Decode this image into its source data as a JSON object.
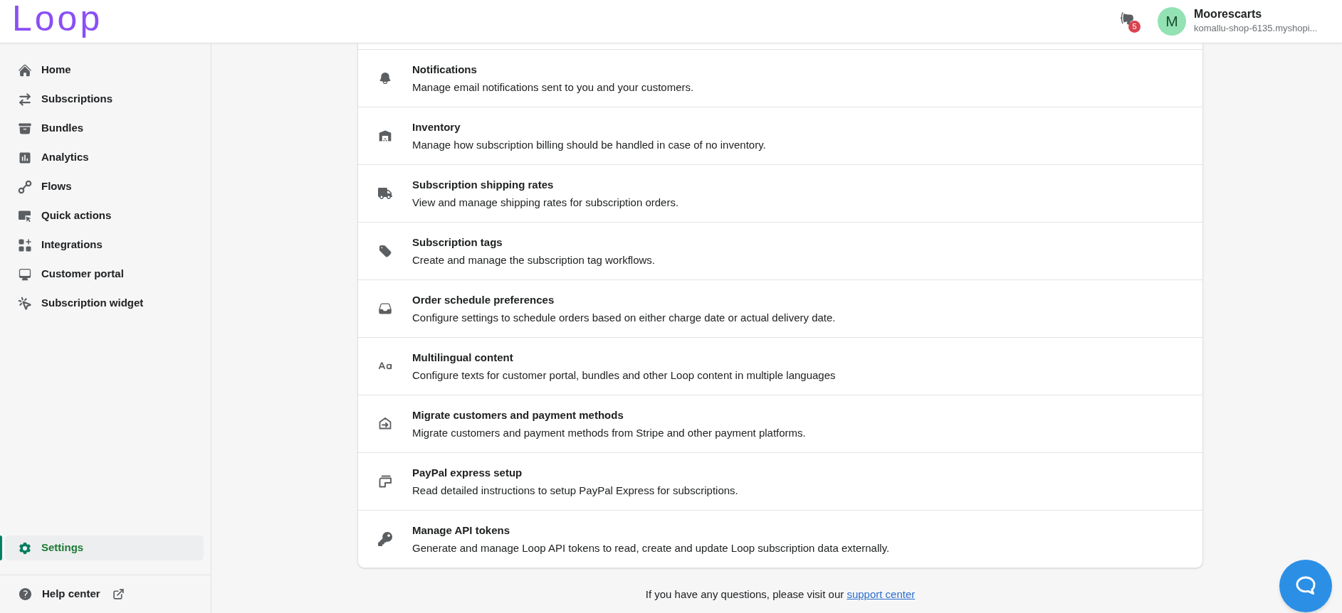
{
  "header": {
    "logo": "Loop",
    "announcements": {
      "badge": "5"
    },
    "account": {
      "avatar_initial": "M",
      "name": "Moorescarts",
      "shop": "komallu-shop-6135.myshopi..."
    }
  },
  "sidebar": {
    "nav_items": [
      {
        "label": "Home",
        "selected": false
      },
      {
        "label": "Subscriptions",
        "selected": false
      },
      {
        "label": "Bundles",
        "selected": false
      },
      {
        "label": "Analytics",
        "selected": false
      },
      {
        "label": "Flows",
        "selected": false
      },
      {
        "label": "Quick actions",
        "selected": false
      },
      {
        "label": "Integrations",
        "selected": false
      },
      {
        "label": "Customer portal",
        "selected": false
      },
      {
        "label": "Subscription widget",
        "selected": false
      }
    ],
    "bottom_items": [
      {
        "label": "Settings",
        "selected": true
      }
    ],
    "help_link": {
      "label": "Help center"
    }
  },
  "settings_list": {
    "rows": [
      {
        "title": "Notifications",
        "description": "Manage email notifications sent to you and your customers."
      },
      {
        "title": "Inventory",
        "description": "Manage how subscription billing should be handled in case of no inventory."
      },
      {
        "title": "Subscription shipping rates",
        "description": "View and manage shipping rates for subscription orders."
      },
      {
        "title": "Subscription tags",
        "description": "Create and manage the subscription tag workflows."
      },
      {
        "title": "Order schedule preferences",
        "description": "Configure settings to schedule orders based on either charge date or actual delivery date."
      },
      {
        "title": "Multilingual content",
        "description": "Configure texts for customer portal, bundles and other Loop content in multiple languages"
      },
      {
        "title": "Migrate customers and payment methods",
        "description": "Migrate customers and payment methods from Stripe and other payment platforms."
      },
      {
        "title": "PayPal express setup",
        "description": "Read detailed instructions to setup PayPal Express for subscriptions."
      },
      {
        "title": "Manage API tokens",
        "description": "Generate and manage Loop API tokens to read, create and update Loop subscription data externally."
      }
    ]
  },
  "footer": {
    "text": "If you have any questions, please visit our",
    "link": "support center"
  }
}
